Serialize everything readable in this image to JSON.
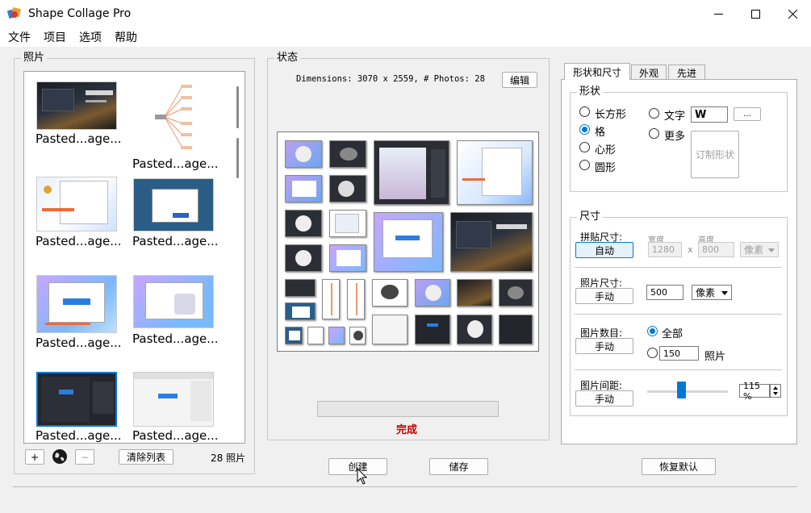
{
  "window": {
    "title": "Shape Collage Pro"
  },
  "menu": [
    "文件",
    "项目",
    "选项",
    "帮助"
  ],
  "photos": {
    "group_label": "照片",
    "items": [
      {
        "label": "Pasted...age..."
      },
      {
        "label": "Pasted...age..."
      },
      {
        "label": "Pasted...age..."
      },
      {
        "label": "Pasted...age..."
      },
      {
        "label": "Pasted...age..."
      },
      {
        "label": "Pasted...age..."
      },
      {
        "label": "Pasted...age..."
      },
      {
        "label": "Pasted...age..."
      }
    ],
    "add_label": "+",
    "remove_label": "−",
    "clear_label": "清除列表",
    "count_text": "28 照片"
  },
  "status": {
    "group_label": "状态",
    "dimensions_text": "Dimensions: 3070 x 2559, # Photos: 28",
    "edit_label": "编辑",
    "done_text": "完成"
  },
  "tabs": [
    "形状和尺寸",
    "外观",
    "先进"
  ],
  "shape": {
    "group_label": "形状",
    "options": [
      "长方形",
      "格",
      "心形",
      "圆形"
    ],
    "selected": "格",
    "text_option": "文字",
    "text_value": "W",
    "text_browse": "...",
    "more_option": "更多",
    "custom_label": "订制形状"
  },
  "size": {
    "group_label": "尺寸",
    "collage_size_label": "拼贴尺寸:",
    "collage_size_button": "自动",
    "width_label": "宽度",
    "height_label": "高度",
    "width_value": "1280",
    "x_label": "x",
    "height_value": "800",
    "unit_disabled": "像素",
    "photo_size_label": "照片尺寸:",
    "photo_size_button": "手动",
    "photo_size_value": "500",
    "photo_size_unit": "像素",
    "photo_count_label": "图片数目:",
    "photo_count_button": "手动",
    "all_option": "全部",
    "count_value": "150",
    "count_unit": "照片",
    "spacing_label": "图片间距:",
    "spacing_button": "手动",
    "spacing_value": "115 %",
    "spacing_fraction": 0.42
  },
  "bottom": {
    "create_label": "创建",
    "save_label": "储存",
    "reset_label": "恢复默认"
  },
  "colors": {
    "accent": "#0078d7",
    "done_text": "#c00000"
  }
}
